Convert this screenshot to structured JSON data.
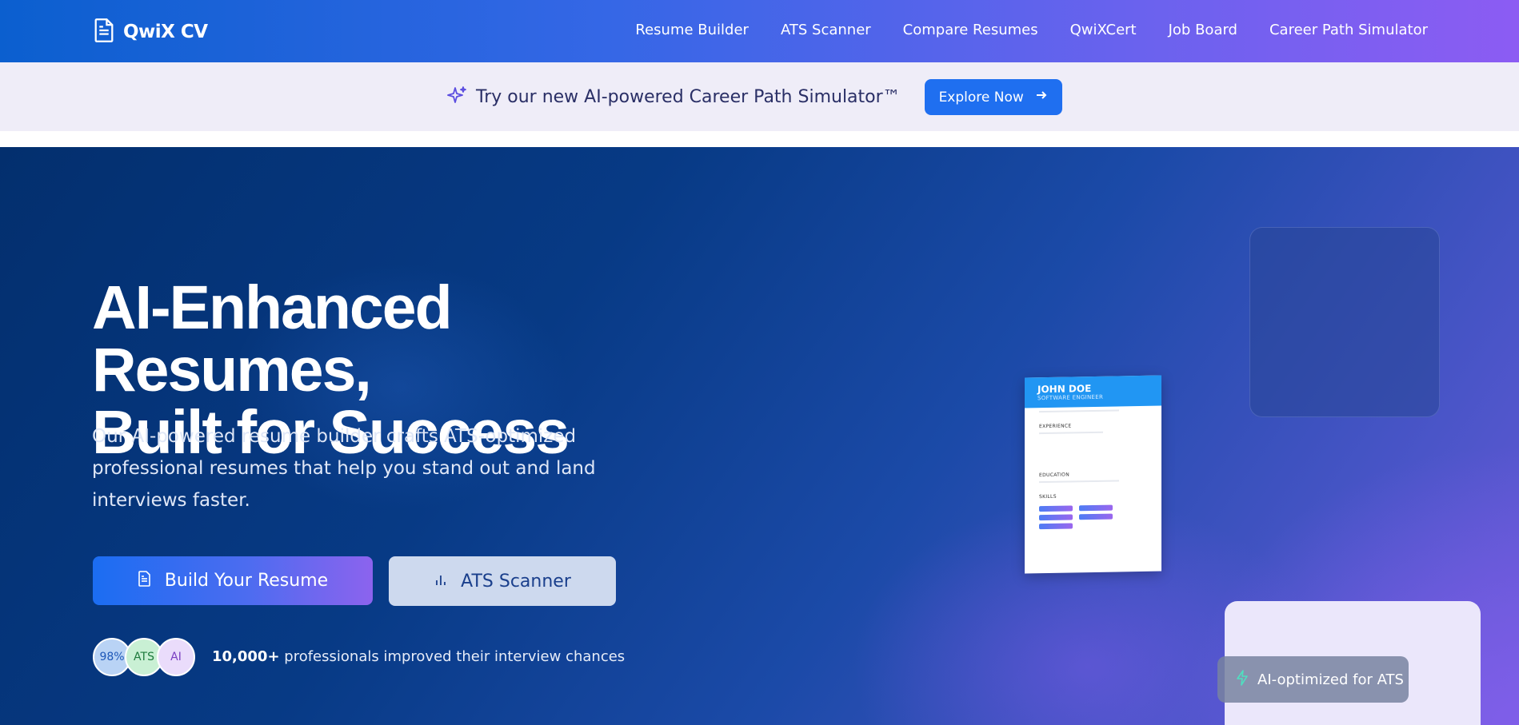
{
  "brand": {
    "name": "QwiX CV",
    "logo_icon": "document-icon"
  },
  "nav": {
    "links": [
      "Resume Builder",
      "ATS Scanner",
      "Compare Resumes",
      "QwiXCert",
      "Job Board",
      "Career Path Simulator"
    ]
  },
  "promo": {
    "icon": "sparkle-icon",
    "text": "Try our new AI-powered Career Path Simulator™",
    "button_label": "Explore Now",
    "button_icon": "arrow-right-icon"
  },
  "hero": {
    "title_line1": "AI-Enhanced Resumes,",
    "title_line2": "Built for Success",
    "subtitle": "Our AI-powered resume builder crafts ATS-optimized professional resumes that help you stand out and land interviews faster.",
    "primary_button": {
      "label": "Build Your Resume",
      "icon": "document-icon"
    },
    "secondary_button": {
      "label": "ATS Scanner",
      "icon": "bar-chart-icon"
    },
    "badges": [
      "98%",
      "ATS",
      "AI"
    ],
    "proof_count": "10,000+",
    "proof_text": "professionals improved their interview chances"
  },
  "resume_preview": {
    "name": "JOHN DOE",
    "title": "SOFTWARE ENGINEER",
    "sections": [
      "EXPERIENCE",
      "EDUCATION",
      "SKILLS"
    ]
  },
  "ats_pill": {
    "icon": "lightning-icon",
    "label": "AI-optimized for ATS"
  },
  "colors": {
    "primary": "#1f6ff0",
    "accent_purple": "#8c5cf3",
    "hero_dark": "#032f6e"
  }
}
